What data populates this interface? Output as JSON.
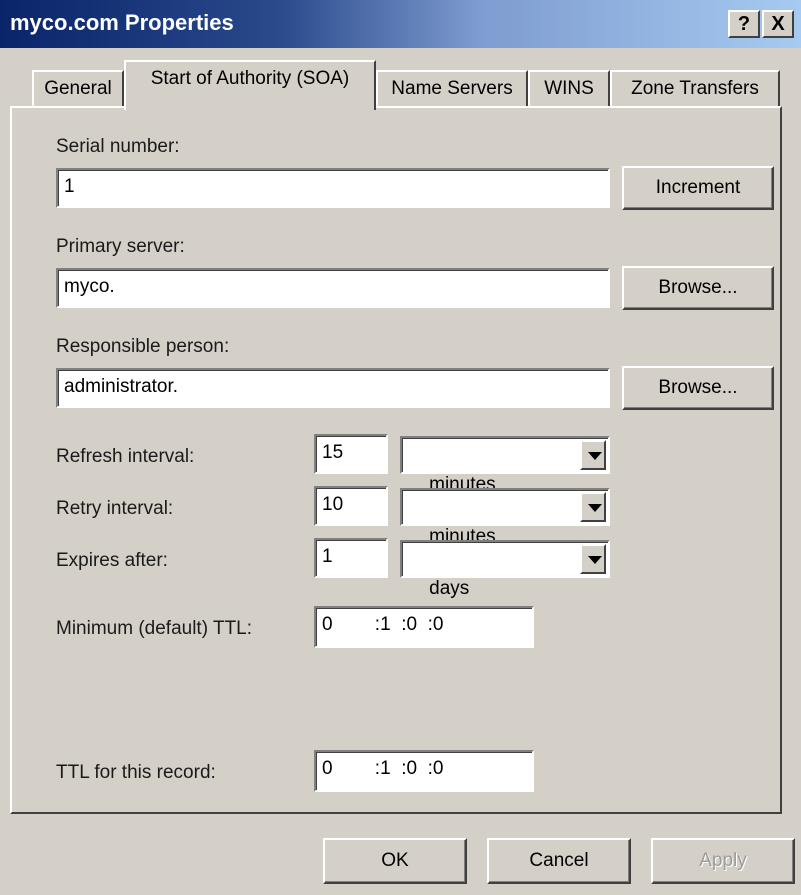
{
  "window": {
    "title": "myco.com Properties",
    "help_label": "?",
    "close_label": "X"
  },
  "tabs": [
    {
      "label": "General"
    },
    {
      "label": "Start of Authority (SOA)",
      "active": true
    },
    {
      "label": "Name Servers"
    },
    {
      "label": "WINS"
    },
    {
      "label": "Zone Transfers"
    }
  ],
  "soa": {
    "serial_label": "Serial number:",
    "serial_value": "1",
    "increment_label": "Increment",
    "primary_label": "Primary server:",
    "primary_value": "myco.",
    "primary_browse": "Browse...",
    "responsible_label": "Responsible person:",
    "responsible_value": "administrator.",
    "responsible_browse": "Browse...",
    "refresh_label": "Refresh interval:",
    "refresh_value": "15",
    "refresh_unit": "minutes",
    "retry_label": "Retry interval:",
    "retry_value": "10",
    "retry_unit": "minutes",
    "expires_label": "Expires after:",
    "expires_value": "1",
    "expires_unit": "days",
    "min_ttl_label": "Minimum (default) TTL:",
    "min_ttl_value": "0        :1  :0  :0",
    "ttl_record_label": "TTL for this record:",
    "ttl_record_value": "0        :1  :0  :0"
  },
  "footer": {
    "ok_label": "OK",
    "cancel_label": "Cancel",
    "apply_label": "Apply"
  }
}
